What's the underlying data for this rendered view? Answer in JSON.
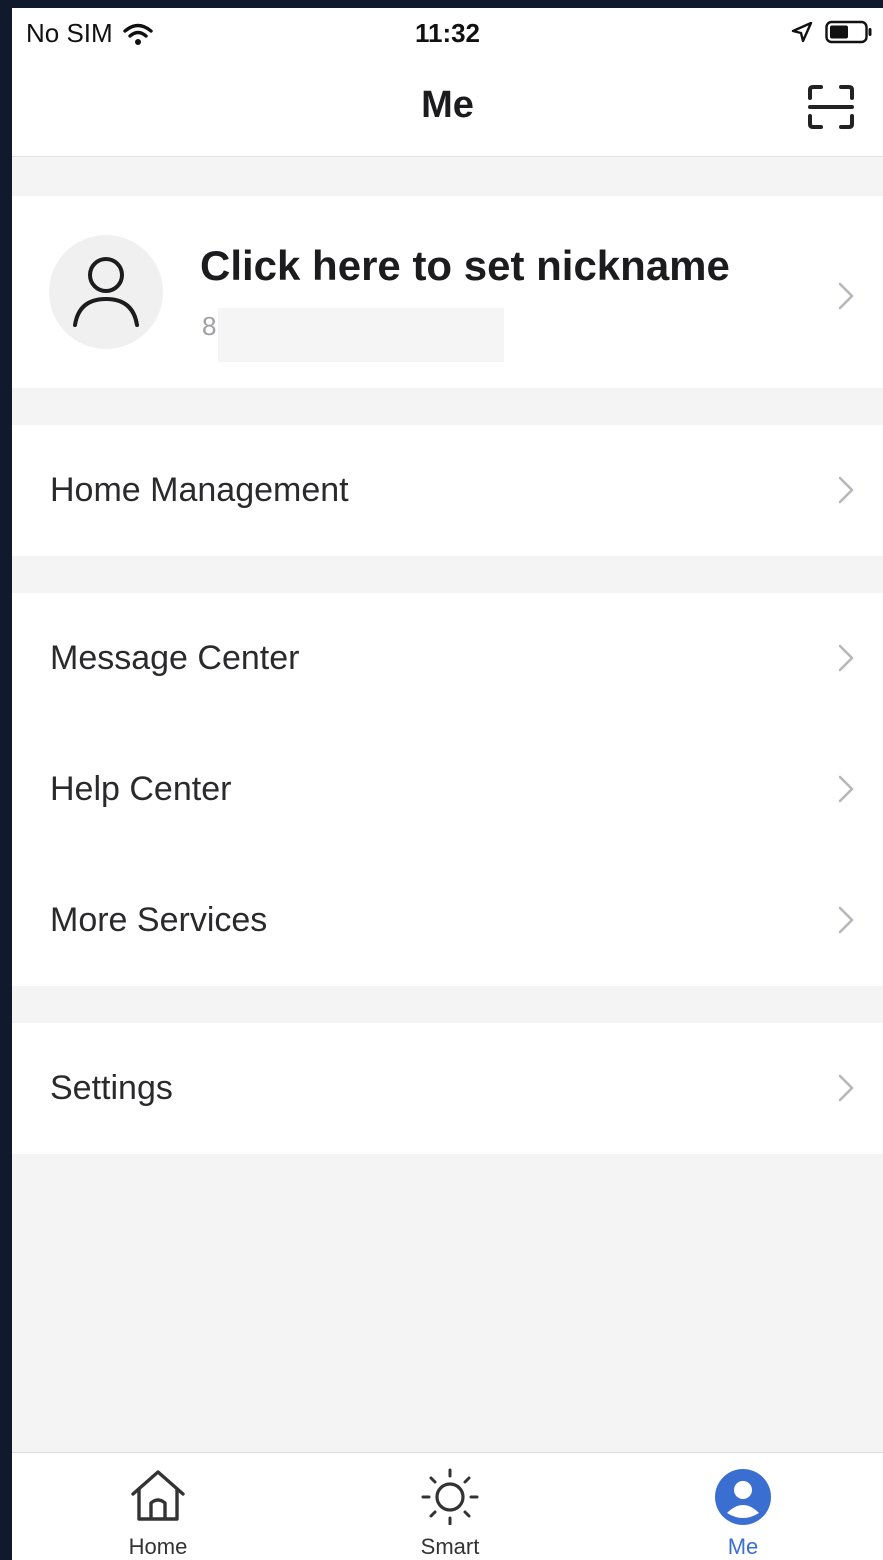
{
  "status_bar": {
    "carrier": "No SIM",
    "time": "11:32",
    "icons": [
      "wifi-icon",
      "location-arrow-icon",
      "battery-icon"
    ]
  },
  "header": {
    "title": "Me",
    "right_icon": "scan-icon"
  },
  "profile": {
    "nickname_prompt": "Click here to set nickname",
    "account_prefix": "8",
    "avatar_icon": "user-avatar-icon"
  },
  "menu": {
    "group1": [
      {
        "label": "Home Management"
      }
    ],
    "group2": [
      {
        "label": "Message Center"
      },
      {
        "label": "Help Center"
      },
      {
        "label": "More Services"
      }
    ],
    "group3": [
      {
        "label": "Settings"
      }
    ]
  },
  "tab_bar": {
    "tabs": [
      {
        "label": "Home",
        "icon": "home-icon",
        "active": false
      },
      {
        "label": "Smart",
        "icon": "sun-icon",
        "active": false
      },
      {
        "label": "Me",
        "icon": "profile-icon",
        "active": true
      }
    ]
  },
  "colors": {
    "accent": "#3a6fd1",
    "background": "#f4f4f5",
    "card": "#ffffff",
    "frame": "#111a2c"
  }
}
